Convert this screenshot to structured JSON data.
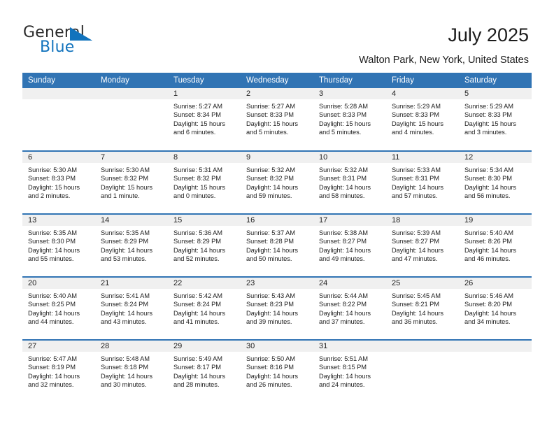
{
  "brand": {
    "word1": "General",
    "word2": "Blue",
    "triangle_color": "#1273bd",
    "icon": "triangle-logo-icon"
  },
  "header": {
    "title": "July 2025",
    "subtitle": "Walton Park, New York, United States",
    "header_bg_color": "#3174b4"
  },
  "calendar": {
    "weekday_headers": [
      "Sunday",
      "Monday",
      "Tuesday",
      "Wednesday",
      "Thursday",
      "Friday",
      "Saturday"
    ],
    "weeks": [
      [
        {
          "empty": true
        },
        {
          "empty": true
        },
        {
          "day": "1",
          "sunrise": "Sunrise: 5:27 AM",
          "sunset": "Sunset: 8:34 PM",
          "daylight": "Daylight: 15 hours and 6 minutes."
        },
        {
          "day": "2",
          "sunrise": "Sunrise: 5:27 AM",
          "sunset": "Sunset: 8:33 PM",
          "daylight": "Daylight: 15 hours and 5 minutes."
        },
        {
          "day": "3",
          "sunrise": "Sunrise: 5:28 AM",
          "sunset": "Sunset: 8:33 PM",
          "daylight": "Daylight: 15 hours and 5 minutes."
        },
        {
          "day": "4",
          "sunrise": "Sunrise: 5:29 AM",
          "sunset": "Sunset: 8:33 PM",
          "daylight": "Daylight: 15 hours and 4 minutes."
        },
        {
          "day": "5",
          "sunrise": "Sunrise: 5:29 AM",
          "sunset": "Sunset: 8:33 PM",
          "daylight": "Daylight: 15 hours and 3 minutes."
        }
      ],
      [
        {
          "day": "6",
          "sunrise": "Sunrise: 5:30 AM",
          "sunset": "Sunset: 8:33 PM",
          "daylight": "Daylight: 15 hours and 2 minutes."
        },
        {
          "day": "7",
          "sunrise": "Sunrise: 5:30 AM",
          "sunset": "Sunset: 8:32 PM",
          "daylight": "Daylight: 15 hours and 1 minute."
        },
        {
          "day": "8",
          "sunrise": "Sunrise: 5:31 AM",
          "sunset": "Sunset: 8:32 PM",
          "daylight": "Daylight: 15 hours and 0 minutes."
        },
        {
          "day": "9",
          "sunrise": "Sunrise: 5:32 AM",
          "sunset": "Sunset: 8:32 PM",
          "daylight": "Daylight: 14 hours and 59 minutes."
        },
        {
          "day": "10",
          "sunrise": "Sunrise: 5:32 AM",
          "sunset": "Sunset: 8:31 PM",
          "daylight": "Daylight: 14 hours and 58 minutes."
        },
        {
          "day": "11",
          "sunrise": "Sunrise: 5:33 AM",
          "sunset": "Sunset: 8:31 PM",
          "daylight": "Daylight: 14 hours and 57 minutes."
        },
        {
          "day": "12",
          "sunrise": "Sunrise: 5:34 AM",
          "sunset": "Sunset: 8:30 PM",
          "daylight": "Daylight: 14 hours and 56 minutes."
        }
      ],
      [
        {
          "day": "13",
          "sunrise": "Sunrise: 5:35 AM",
          "sunset": "Sunset: 8:30 PM",
          "daylight": "Daylight: 14 hours and 55 minutes."
        },
        {
          "day": "14",
          "sunrise": "Sunrise: 5:35 AM",
          "sunset": "Sunset: 8:29 PM",
          "daylight": "Daylight: 14 hours and 53 minutes."
        },
        {
          "day": "15",
          "sunrise": "Sunrise: 5:36 AM",
          "sunset": "Sunset: 8:29 PM",
          "daylight": "Daylight: 14 hours and 52 minutes."
        },
        {
          "day": "16",
          "sunrise": "Sunrise: 5:37 AM",
          "sunset": "Sunset: 8:28 PM",
          "daylight": "Daylight: 14 hours and 50 minutes."
        },
        {
          "day": "17",
          "sunrise": "Sunrise: 5:38 AM",
          "sunset": "Sunset: 8:27 PM",
          "daylight": "Daylight: 14 hours and 49 minutes."
        },
        {
          "day": "18",
          "sunrise": "Sunrise: 5:39 AM",
          "sunset": "Sunset: 8:27 PM",
          "daylight": "Daylight: 14 hours and 47 minutes."
        },
        {
          "day": "19",
          "sunrise": "Sunrise: 5:40 AM",
          "sunset": "Sunset: 8:26 PM",
          "daylight": "Daylight: 14 hours and 46 minutes."
        }
      ],
      [
        {
          "day": "20",
          "sunrise": "Sunrise: 5:40 AM",
          "sunset": "Sunset: 8:25 PM",
          "daylight": "Daylight: 14 hours and 44 minutes."
        },
        {
          "day": "21",
          "sunrise": "Sunrise: 5:41 AM",
          "sunset": "Sunset: 8:24 PM",
          "daylight": "Daylight: 14 hours and 43 minutes."
        },
        {
          "day": "22",
          "sunrise": "Sunrise: 5:42 AM",
          "sunset": "Sunset: 8:24 PM",
          "daylight": "Daylight: 14 hours and 41 minutes."
        },
        {
          "day": "23",
          "sunrise": "Sunrise: 5:43 AM",
          "sunset": "Sunset: 8:23 PM",
          "daylight": "Daylight: 14 hours and 39 minutes."
        },
        {
          "day": "24",
          "sunrise": "Sunrise: 5:44 AM",
          "sunset": "Sunset: 8:22 PM",
          "daylight": "Daylight: 14 hours and 37 minutes."
        },
        {
          "day": "25",
          "sunrise": "Sunrise: 5:45 AM",
          "sunset": "Sunset: 8:21 PM",
          "daylight": "Daylight: 14 hours and 36 minutes."
        },
        {
          "day": "26",
          "sunrise": "Sunrise: 5:46 AM",
          "sunset": "Sunset: 8:20 PM",
          "daylight": "Daylight: 14 hours and 34 minutes."
        }
      ],
      [
        {
          "day": "27",
          "sunrise": "Sunrise: 5:47 AM",
          "sunset": "Sunset: 8:19 PM",
          "daylight": "Daylight: 14 hours and 32 minutes."
        },
        {
          "day": "28",
          "sunrise": "Sunrise: 5:48 AM",
          "sunset": "Sunset: 8:18 PM",
          "daylight": "Daylight: 14 hours and 30 minutes."
        },
        {
          "day": "29",
          "sunrise": "Sunrise: 5:49 AM",
          "sunset": "Sunset: 8:17 PM",
          "daylight": "Daylight: 14 hours and 28 minutes."
        },
        {
          "day": "30",
          "sunrise": "Sunrise: 5:50 AM",
          "sunset": "Sunset: 8:16 PM",
          "daylight": "Daylight: 14 hours and 26 minutes."
        },
        {
          "day": "31",
          "sunrise": "Sunrise: 5:51 AM",
          "sunset": "Sunset: 8:15 PM",
          "daylight": "Daylight: 14 hours and 24 minutes."
        },
        {
          "empty": true
        },
        {
          "empty": true
        }
      ]
    ]
  }
}
